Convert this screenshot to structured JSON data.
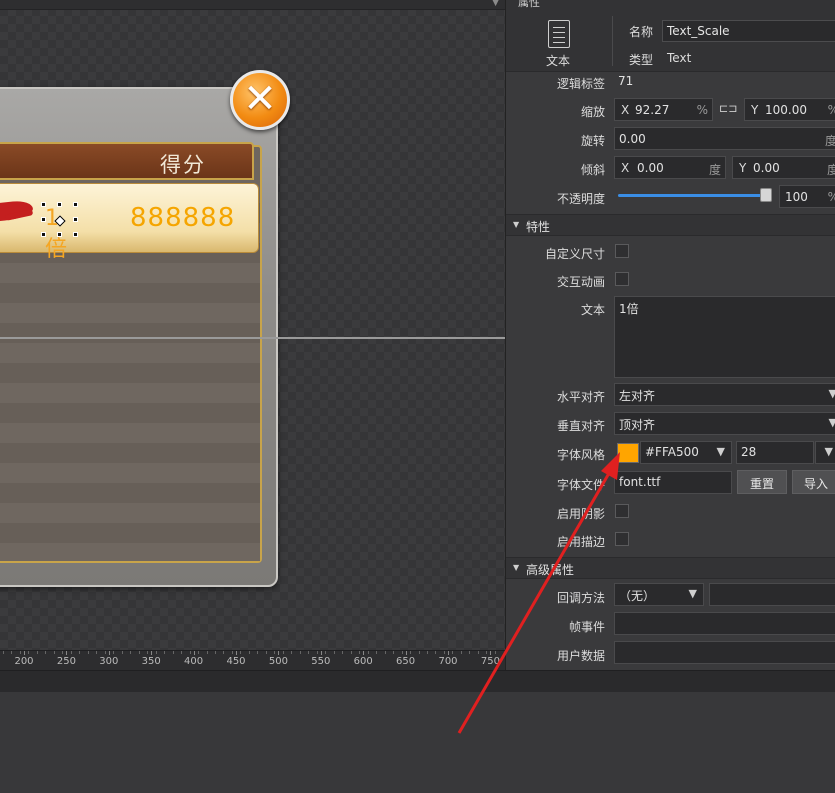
{
  "panel": {
    "title": "属性",
    "object_icon": "text-document-icon",
    "object_icon_label": "文本",
    "name_label": "名称",
    "name_value": "Text_Scale",
    "type_label": "类型",
    "type_value": "Text"
  },
  "props": {
    "logic_tag_label": "逻辑标签",
    "logic_tag_value": "71",
    "scale_label": "缩放",
    "scale_x_prefix": "X",
    "scale_x_value": "92.27",
    "scale_x_unit": "%",
    "link_icon": "link-icon",
    "scale_y_prefix": "Y",
    "scale_y_value": "100.00",
    "scale_y_unit": "%",
    "rotation_label": "旋转",
    "rotation_value": "0.00",
    "rotation_unit": "度",
    "skew_label": "倾斜",
    "skew_x_prefix": "X",
    "skew_x_value": "0.00",
    "skew_x_unit": "度",
    "skew_y_prefix": "Y",
    "skew_y_value": "0.00",
    "skew_y_unit": "度",
    "opacity_label": "不透明度",
    "opacity_value": "100",
    "opacity_unit": "%",
    "opacity_fraction": 1.0
  },
  "features": {
    "section_title": "特性",
    "custom_size_label": "自定义尺寸",
    "interactive_anim_label": "交互动画",
    "text_label": "文本",
    "text_value": "1倍",
    "h_align_label": "水平对齐",
    "h_align_value": "左对齐",
    "v_align_label": "垂直对齐",
    "v_align_value": "顶对齐",
    "font_style_label": "字体风格",
    "font_color_hex": "#FFA500",
    "font_size_value": "28",
    "font_file_label": "字体文件",
    "font_file_value": "font.ttf",
    "reset_button": "重置",
    "import_button": "导入",
    "enable_shadow_label": "启用阴影",
    "enable_outline_label": "启用描边"
  },
  "advanced": {
    "section_title": "高级属性",
    "callback_label": "回调方法",
    "callback_value": "（无）",
    "frame_event_label": "帧事件",
    "user_data_label": "用户数据"
  },
  "canvas": {
    "score_header": "得分",
    "score_value": "888888",
    "selected_text": "1倍",
    "close_icon": "close-icon",
    "ruler_ticks": [
      "200",
      "250",
      "300",
      "350",
      "400",
      "450",
      "500",
      "550",
      "600",
      "650",
      "700",
      "750"
    ]
  },
  "colors": {
    "font_color": "#FFA500",
    "accent_blue": "#3A8EE6",
    "arrow_red": "#E02020"
  }
}
